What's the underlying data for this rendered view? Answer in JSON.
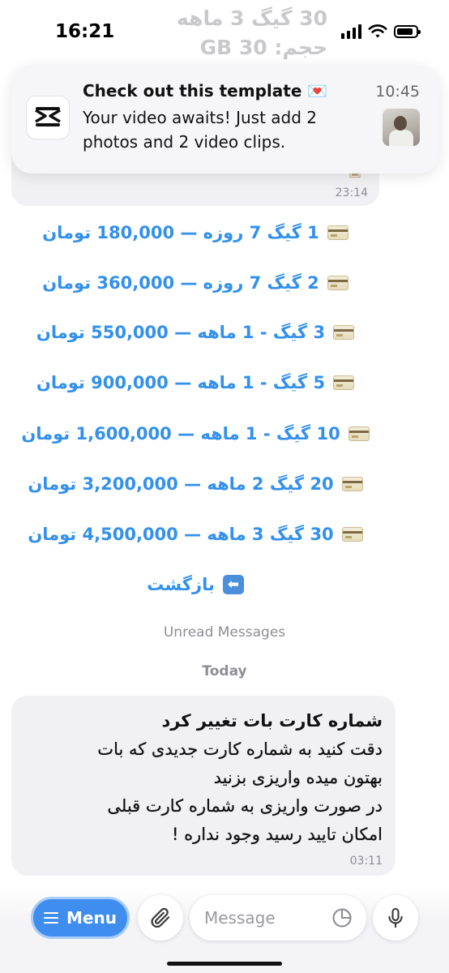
{
  "status_bar": {
    "time": "16:21"
  },
  "background_chat": {
    "line1": "30 گیگ 3 ماهه",
    "line2": "حجم: 30 GB",
    "previous_message_time": "23:14"
  },
  "notification": {
    "title": "Check out this template 💌",
    "body": "Your video awaits! Just add 2 photos and 2 video clips.",
    "time": "10:45",
    "app_icon": "capcut-icon"
  },
  "keyboard_buttons": [
    {
      "label": "1 گیگ 7 روزه — 180,000 تومان",
      "icon": "credit-card-icon"
    },
    {
      "label": "2 گیگ 7 روزه — 360,000 تومان",
      "icon": "credit-card-icon"
    },
    {
      "label": "3 گیگ - 1 ماهه — 550,000 تومان",
      "icon": "credit-card-icon"
    },
    {
      "label": "5 گیگ - 1 ماهه — 900,000 تومان",
      "icon": "credit-card-icon"
    },
    {
      "label": "10 گیگ - 1 ماهه — 1,600,000 تومان",
      "icon": "credit-card-icon"
    },
    {
      "label": "20 گیگ 2 ماهه — 3,200,000 تومان",
      "icon": "credit-card-icon"
    },
    {
      "label": "30 گیگ 3 ماهه  — 4,500,000 تومان",
      "icon": "credit-card-icon"
    },
    {
      "label": "بازگشت",
      "icon": "back-arrow-icon"
    }
  ],
  "separators": {
    "unread": "Unread Messages",
    "today": "Today"
  },
  "message": {
    "heading": "شماره کارت بات تغییر کرد",
    "line1": " دقت کنید به شماره کارت جدیدی که بات",
    "line2": "بهتون میده واریزی بزنید",
    "line3": " در صورت واریزی به شماره کارت قبلی",
    "line4": "امکان تایید رسید وجود نداره !",
    "time": "03:11"
  },
  "composer": {
    "menu_label": "Menu",
    "placeholder": "Message",
    "value": ""
  },
  "colors": {
    "accent": "#3390ec",
    "menu_button": "#3f8def",
    "bubble": "#f1f1f3"
  }
}
